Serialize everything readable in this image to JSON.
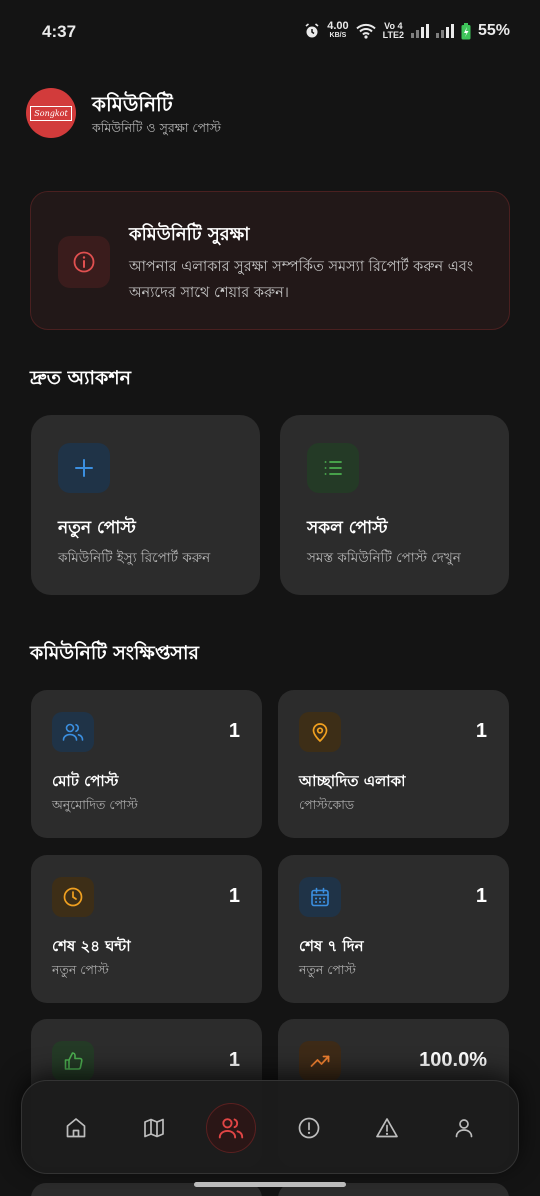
{
  "status_bar": {
    "time": "4:37",
    "net_speed": "4.00",
    "net_unit": "KB/S",
    "volte_1": "Vo 4",
    "volte_2": "LTE2",
    "battery": "55%"
  },
  "header": {
    "title": "কমিউনিটি",
    "subtitle": "কমিউনিটি ও সুরক্ষা পোস্ট",
    "logo_text": "Songkot"
  },
  "alert": {
    "title": "কমিউনিটি সুরক্ষা",
    "body": "আপনার এলাকার সুরক্ষা সম্পর্কিত সমস্যা রিপোর্ট করুন এবং অন্যদের সাথে শেয়ার করুন।",
    "icon": "info-icon",
    "color": "#e05050"
  },
  "quick_actions": {
    "title": "দ্রুত অ্যাকশন",
    "items": [
      {
        "title": "নতুন পোস্ট",
        "subtitle": "কমিউনিটি ইস্যু রিপোর্ট করুন",
        "icon": "plus-icon",
        "color": "#3b8fe0"
      },
      {
        "title": "সকল পোস্ট",
        "subtitle": "সমস্ত কমিউনিটি পোস্ট দেখুন",
        "icon": "list-icon",
        "color": "#4caf50"
      }
    ]
  },
  "summary": {
    "title": "কমিউনিটি সংক্ষিপ্তসার",
    "cards": [
      {
        "title": "মোট পোস্ট",
        "subtitle": "অনুমোদিত পোস্ট",
        "value": "1",
        "icon": "users-icon",
        "color": "#3b8fe0"
      },
      {
        "title": "আচ্ছাদিত এলাকা",
        "subtitle": "পোস্টকোড",
        "value": "1",
        "icon": "map-pin-icon",
        "color": "#f0a020"
      },
      {
        "title": "শেষ ২৪ ঘন্টা",
        "subtitle": "নতুন পোস্ট",
        "value": "1",
        "icon": "clock-icon",
        "color": "#f0a020"
      },
      {
        "title": "শেষ ৭ দিন",
        "subtitle": "নতুন পোস্ট",
        "value": "1",
        "icon": "calendar-icon",
        "color": "#3b8fe0"
      },
      {
        "title": "",
        "subtitle": "",
        "value": "1",
        "icon": "thumbs-up-icon",
        "color": "#4caf50"
      },
      {
        "title": "",
        "subtitle": "",
        "value": "100.0%",
        "icon": "trending-up-icon",
        "color": "#f08030"
      }
    ]
  },
  "bottom_nav": {
    "items": [
      {
        "icon": "home-icon",
        "active": false
      },
      {
        "icon": "map-icon",
        "active": false
      },
      {
        "icon": "community-icon",
        "active": true
      },
      {
        "icon": "alert-circle-icon",
        "active": false
      },
      {
        "icon": "warning-triangle-icon",
        "active": false
      },
      {
        "icon": "profile-icon",
        "active": false
      }
    ],
    "active_color": "#e04545",
    "inactive_color": "#bdbdbd"
  }
}
